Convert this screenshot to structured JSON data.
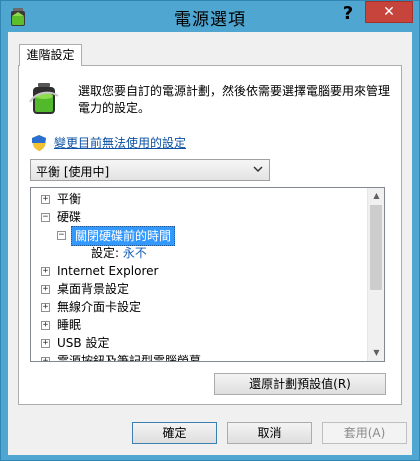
{
  "window": {
    "title": "電源選項",
    "help_label": "?",
    "close_label": "✕"
  },
  "tab": {
    "label": "進階設定"
  },
  "description": "選取您要自訂的電源計劃，然後依需要選擇電腦要用來管理電力的設定。",
  "change_link": "變更目前無法使用的設定",
  "plan_select": {
    "value": "平衡 [使用中]"
  },
  "tree": {
    "items": [
      {
        "label": "平衡",
        "expander": "+"
      },
      {
        "label": "硬碟",
        "expander": "−"
      },
      {
        "label": "關閉硬碟前的時間",
        "expander": "−"
      },
      {
        "setting_label": "設定:",
        "setting_value": "永不"
      },
      {
        "label": "Internet Explorer",
        "expander": "+"
      },
      {
        "label": "桌面背景設定",
        "expander": "+"
      },
      {
        "label": "無線介面卡設定",
        "expander": "+"
      },
      {
        "label": "睡眠",
        "expander": "+"
      },
      {
        "label": "USB 設定",
        "expander": "+"
      },
      {
        "label": "電源按鈕及筆記型電腦螢幕",
        "expander": "+"
      }
    ]
  },
  "buttons": {
    "restore": "還原計劃預設值(R)",
    "ok": "確定",
    "cancel": "取消",
    "apply": "套用(A)"
  },
  "colors": {
    "title_bar": "#4ea6d1",
    "close": "#c7443c",
    "link": "#0b4fa4",
    "selection": "#3399ff"
  }
}
